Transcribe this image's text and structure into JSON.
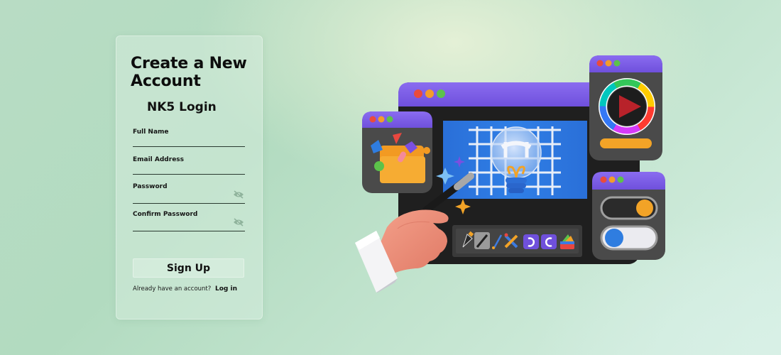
{
  "form": {
    "title": "Create a New Account",
    "subtitle": "NK5 Login",
    "fields": [
      {
        "label": "Full Name",
        "value": "",
        "type": "text"
      },
      {
        "label": "Email Address",
        "value": "",
        "type": "email"
      },
      {
        "label": "Password",
        "value": "",
        "type": "password",
        "icon": "eye-off-icon"
      },
      {
        "label": "Confirm Password",
        "value": "",
        "type": "password",
        "icon": "eye-off-icon"
      }
    ],
    "submit_label": "Sign Up",
    "login_prompt": "Already have an account?",
    "login_link": "Log in"
  },
  "illustration": {
    "description": "3D design app windows with hand holding magic wand",
    "colors": {
      "window_header": "#7b5ce6",
      "window_body": "#2b2b2b",
      "panel_body": "#4a4a4a",
      "canvas_blue": "#2f7de0",
      "dot_red": "#ea4b3c",
      "dot_orange": "#f39c2b",
      "dot_green": "#5cc24a",
      "accent_orange": "#f2a327",
      "toggle_blue": "#2f7de0"
    },
    "toolbar_tools": [
      "pen-tool-icon",
      "magic-wand-icon",
      "brush-icon",
      "ruler-pencil-icon",
      "undo-icon",
      "redo-icon",
      "color-palette-icon"
    ]
  }
}
